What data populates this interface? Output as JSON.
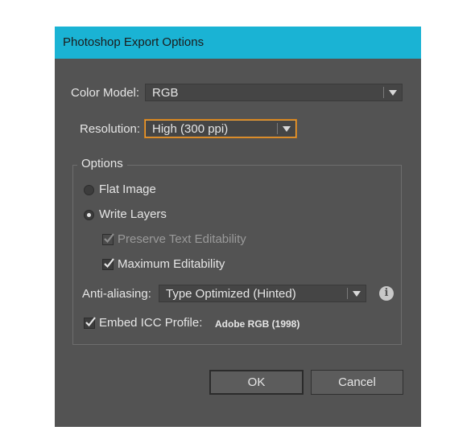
{
  "dialog": {
    "title": "Photoshop Export Options",
    "titlebar_color": "#1ab3d4"
  },
  "color_model": {
    "label": "Color Model:",
    "value": "RGB"
  },
  "resolution": {
    "label": "Resolution:",
    "value": "High (300 ppi)"
  },
  "options": {
    "legend": "Options",
    "flat_image": {
      "label": "Flat Image",
      "selected": false
    },
    "write_layers": {
      "label": "Write Layers",
      "selected": true
    },
    "preserve_text": {
      "label": "Preserve Text Editability",
      "checked": true,
      "enabled": false
    },
    "max_editability": {
      "label": "Maximum Editability",
      "checked": true,
      "enabled": true
    },
    "anti_aliasing": {
      "label": "Anti-aliasing:",
      "value": "Type Optimized (Hinted)",
      "info_icon": "info-icon"
    },
    "embed_icc": {
      "label": "Embed ICC Profile:",
      "checked": true,
      "profile": "Adobe RGB (1998)"
    }
  },
  "buttons": {
    "ok": "OK",
    "cancel": "Cancel"
  }
}
